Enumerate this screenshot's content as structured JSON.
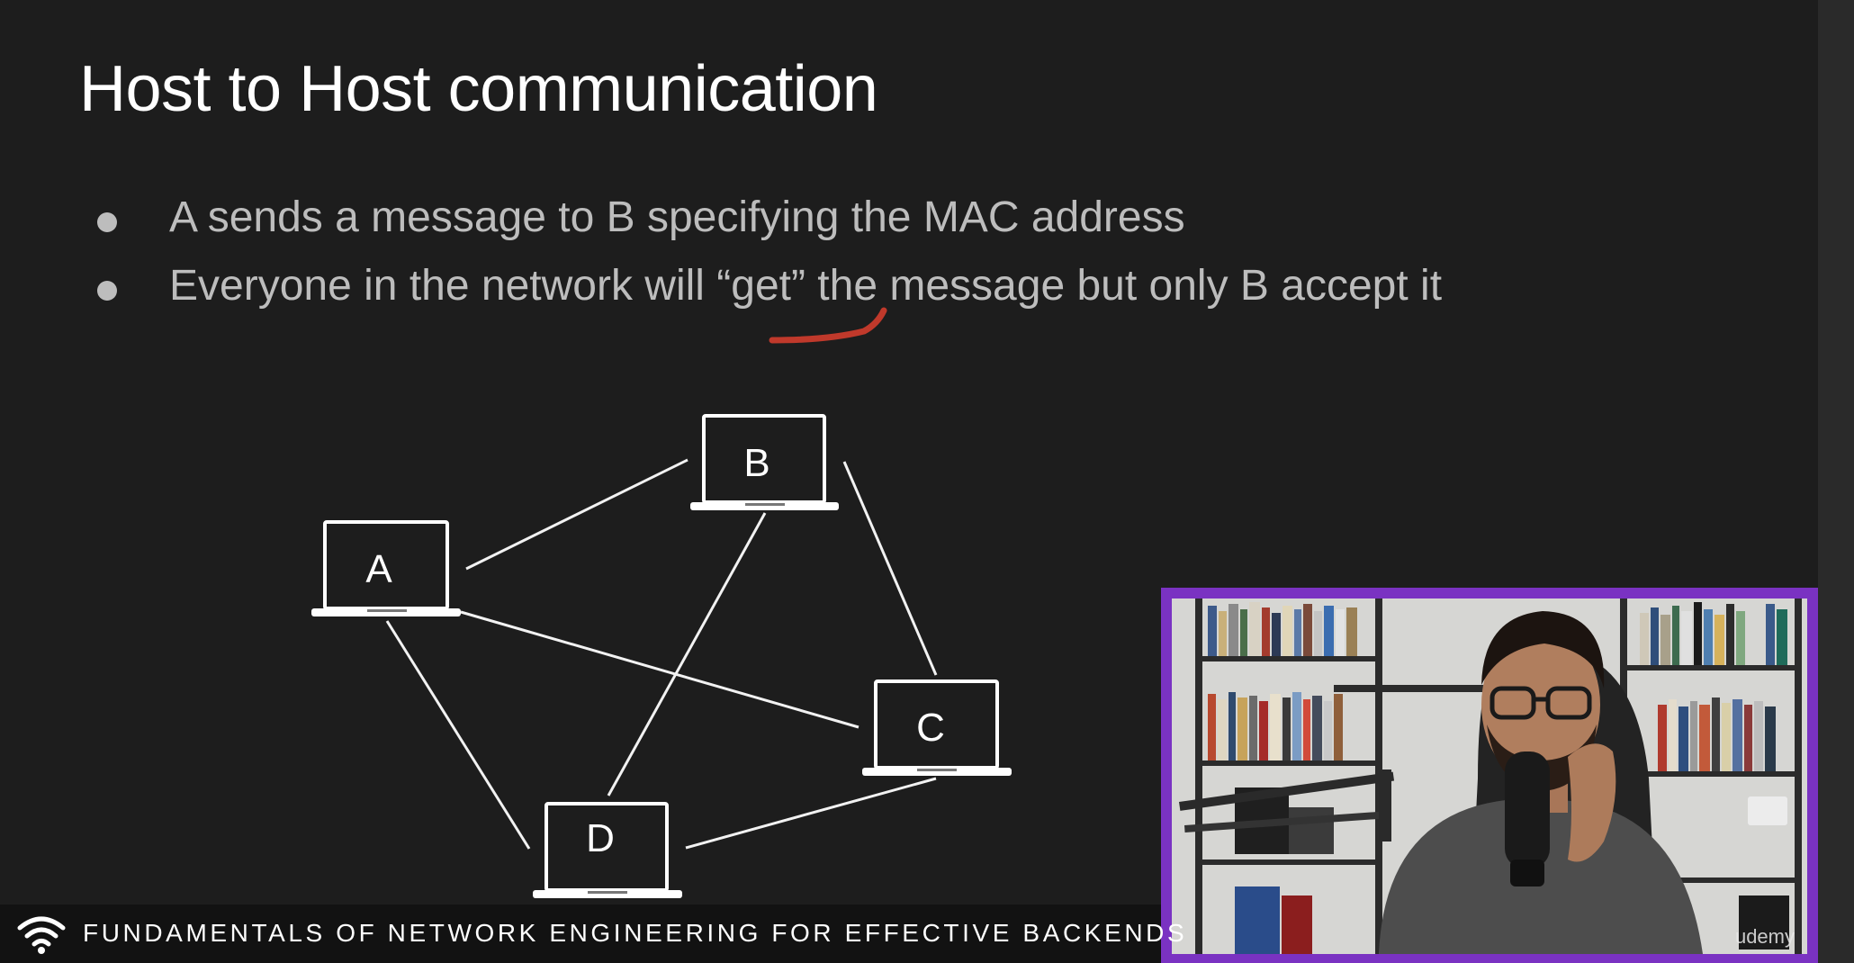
{
  "slide": {
    "title": "Host to Host communication",
    "bullets": [
      "A sends a message to B specifying the MAC address",
      "Everyone in the network will “get” the message but only B accept it"
    ]
  },
  "diagram": {
    "hosts": [
      {
        "id": "A",
        "label": "A"
      },
      {
        "id": "B",
        "label": "B"
      },
      {
        "id": "C",
        "label": "C"
      },
      {
        "id": "D",
        "label": "D"
      }
    ],
    "links": [
      [
        "A",
        "B"
      ],
      [
        "A",
        "C"
      ],
      [
        "A",
        "D"
      ],
      [
        "B",
        "C"
      ],
      [
        "B",
        "D"
      ],
      [
        "D",
        "C"
      ]
    ]
  },
  "colors": {
    "background": "#1d1d1d",
    "webcam_border": "#7a32c2",
    "annotation": "#c0392b"
  },
  "webcam": {
    "watermark": "udemy"
  },
  "footer": {
    "icon": "wifi-icon",
    "course_title": "FUNDAMENTALS OF NETWORK ENGINEERING FOR EFFECTIVE BACKENDS"
  }
}
